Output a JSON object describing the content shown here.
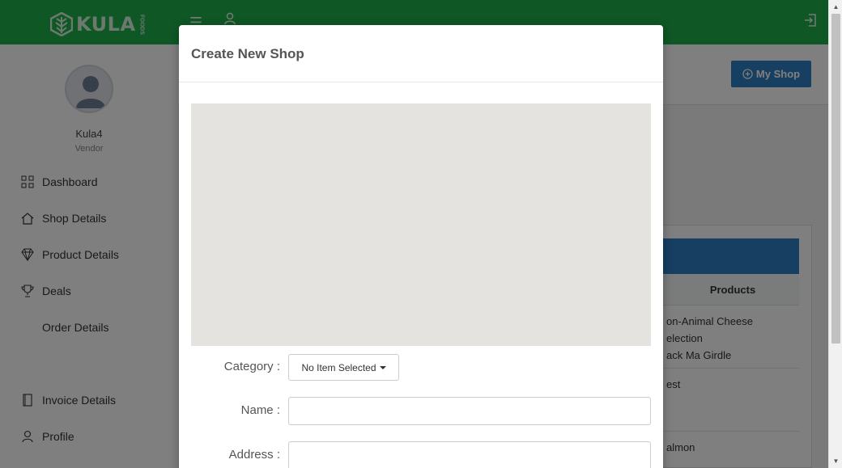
{
  "app": {
    "logo_text": "KULA",
    "logo_sub": "FOODS",
    "brand_color": "#1fae4b"
  },
  "sidebar": {
    "user_name": "Kula4",
    "user_role": "Vendor",
    "items": [
      {
        "label": "Dashboard",
        "icon": "dashboard-grid-icon"
      },
      {
        "label": "Shop Details",
        "icon": "home-icon"
      },
      {
        "label": "Product Details",
        "icon": "diamond-icon"
      },
      {
        "label": "Deals",
        "icon": "trophy-icon"
      },
      {
        "label": "Order Details",
        "icon": ""
      },
      {
        "label": "Invoice Details",
        "icon": "document-icon"
      },
      {
        "label": "Profile",
        "icon": "user-icon"
      }
    ]
  },
  "main": {
    "my_shop_button": "My Shop",
    "table": {
      "column_header": "Products",
      "rows": [
        {
          "lines": [
            "on-Animal Cheese",
            "election",
            "ack Ma Girdle"
          ]
        },
        {
          "lines": [
            "est"
          ]
        },
        {
          "lines": [
            "almon"
          ]
        }
      ]
    }
  },
  "modal": {
    "title": "Create New Shop",
    "category_label": "Category :",
    "category_value": "No Item Selected",
    "name_label": "Name :",
    "name_value": "",
    "address_label": "Address :",
    "address_value": ""
  }
}
